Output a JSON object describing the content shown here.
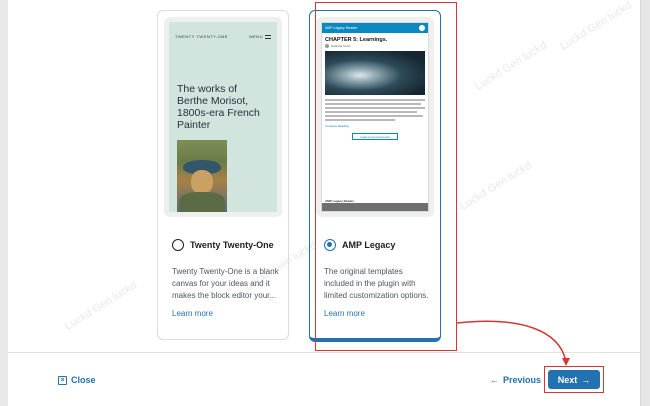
{
  "cards": [
    {
      "name": "Twenty Twenty-One",
      "selected": false,
      "description": "Twenty Twenty-One is a blank canvas for your ideas and it makes the block editor your...",
      "link": "Learn more",
      "preview": {
        "site_title": "TWENTY TWENTY-ONE",
        "menu_label": "MENU",
        "heading": "The works of Berthe Morisot, 1800s-era French Painter"
      }
    },
    {
      "name": "AMP Legacy",
      "selected": true,
      "description": "The original templates included in the plugin with limited customization options.",
      "link": "Learn more",
      "preview": {
        "site_title": "AMP Legacy Reader",
        "title": "CHAPTER 5: Learnings.",
        "author": "Natasha Smith",
        "read_more": "Continue Reading",
        "button": "Load more Comments",
        "footer": "AMP Legacy Reader"
      }
    }
  ],
  "footer": {
    "close_label": "Close",
    "previous_label": "Previous",
    "next_label": "Next"
  },
  "watermark": "Luckd Gen luckd",
  "colors": {
    "accent": "#2271b1",
    "annotation": "#d63638"
  }
}
